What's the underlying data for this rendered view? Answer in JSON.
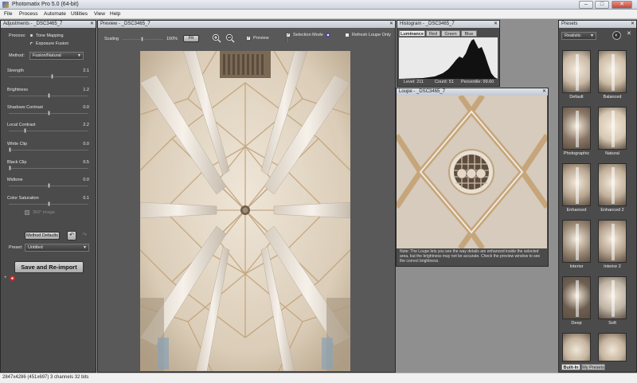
{
  "window": {
    "title": "Photomatix Pro 5.0 (64-bit)",
    "min": "–",
    "max": "□",
    "close": "✕"
  },
  "menu": [
    "File",
    "Process",
    "Automate",
    "Utilities",
    "View",
    "Help"
  ],
  "adjustments": {
    "title": "Adjustments - _DSC3465_7",
    "process_label": "Process:",
    "process_options": [
      "Tone Mapping",
      "Exposure Fusion"
    ],
    "process_selected": "Exposure Fusion",
    "method_label": "Method:",
    "method_value": "Fusion/Natural",
    "sliders": [
      {
        "label": "Strength",
        "value": "2.1",
        "fraction": 0.55
      },
      {
        "label": "Brightness",
        "value": "1.2",
        "fraction": 0.5
      },
      {
        "label": "Shadows Contrast",
        "value": "0.0",
        "fraction": 0.5
      },
      {
        "label": "Local Contrast",
        "value": "2.2",
        "fraction": 0.2
      },
      {
        "label": "White Clip",
        "value": "0.0",
        "fraction": 0.0
      },
      {
        "label": "Black Clip",
        "value": "0.5",
        "fraction": 0.0
      },
      {
        "label": "Midtone",
        "value": "0.0",
        "fraction": 0.5
      },
      {
        "label": "Color Saturation",
        "value": "0.1",
        "fraction": 0.5
      }
    ],
    "checkbox_label": "360° image",
    "method_defaults": "Method Defaults",
    "preset_label": "Preset:",
    "preset_value": "Untitled",
    "save_button": "Save and Re-import",
    "more_options": "+"
  },
  "preview": {
    "title": "Preview - _DSC3465_7",
    "scaling_label": "Scaling",
    "scaling_value": "100%",
    "fit": "Fit",
    "preview_label": "Preview",
    "selection_mode": "Selection Mode",
    "refresh_loupe": "Refresh Loupe Only"
  },
  "histogram": {
    "title": "Histogram - _DSC3465_7",
    "tabs": [
      "Luminance",
      "Red",
      "Green",
      "Blue"
    ],
    "active_tab": "Luminance",
    "level": "Level: 211",
    "count": "Count: 51",
    "percentile": "Percentile: 99.60"
  },
  "loupe": {
    "title": "Loupe - _DSC3465_7",
    "note": "Note: The Loupe lets you see the way details are enhanced inside the selected area, but the brightness may not be accurate. Check the preview window to see the correct brightness."
  },
  "presets": {
    "title": "Presets",
    "dropdown": "Realistic",
    "items": [
      "Default",
      "Balanced",
      "Photographic",
      "Natural",
      "Enhanced",
      "Enhanced 2",
      "Interior",
      "Interior 2",
      "Deep",
      "Soft"
    ],
    "tabs": [
      "Built-In",
      "My Presets"
    ],
    "active_tab": "Built-In"
  },
  "status": "2847x4286 (451x697) 3 channels 32 bits"
}
